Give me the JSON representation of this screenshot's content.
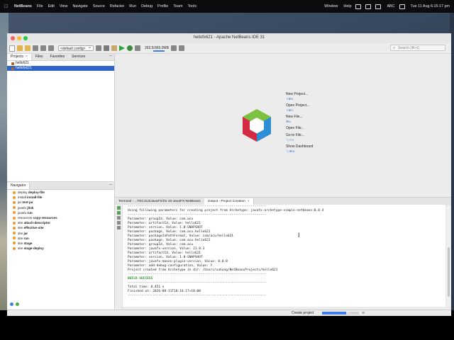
{
  "menubar": {
    "app": "NetBeans",
    "items": [
      "File",
      "Edit",
      "View",
      "Navigate",
      "Source",
      "Refactor",
      "Run",
      "Debug",
      "Profile",
      "Team",
      "Tools"
    ],
    "right_items": [
      "Window",
      "Help"
    ],
    "datetime": "Tue 11 Aug  6:15:17 pm",
    "input_label": "ABC"
  },
  "window": {
    "title": "hellofx621 - Apache NetBeans IDE 31"
  },
  "toolbar": {
    "config": "<default config>",
    "memory": "263.5/365.0MB",
    "search_placeholder": "Search (⌘+I)"
  },
  "projects_panel": {
    "tabs": [
      "Projects",
      "Files",
      "Favorites",
      "Services"
    ],
    "items": [
      {
        "label": "hello621",
        "selected": false
      },
      {
        "label": "hellofx621",
        "selected": true
      }
    ]
  },
  "navigator": {
    "title": "Navigator",
    "items": [
      {
        "phase": "deploy",
        "goal": "deploy-file"
      },
      {
        "phase": "install",
        "goal": "install-file"
      },
      {
        "phase": "jar",
        "goal": "test-jar"
      },
      {
        "phase": "javafx",
        "goal": "jlink"
      },
      {
        "phase": "javafx",
        "goal": "run"
      },
      {
        "phase": "resources",
        "goal": "copy-resources"
      },
      {
        "phase": "site",
        "goal": "attach-descriptor"
      },
      {
        "phase": "site",
        "goal": "effective-site"
      },
      {
        "phase": "site",
        "goal": "jar"
      },
      {
        "phase": "site",
        "goal": "run"
      },
      {
        "phase": "site",
        "goal": "stage"
      },
      {
        "phase": "site",
        "goal": "stage-deploy"
      }
    ]
  },
  "start_page": {
    "links": [
      {
        "label": "New Project...",
        "shortcut": "⇧⌘N"
      },
      {
        "label": "Open Project...",
        "shortcut": "⇧⌘O"
      },
      {
        "label": "New File...",
        "shortcut": "⌘N"
      },
      {
        "label": "Open File...",
        "shortcut": ""
      },
      {
        "label": "Go to File...",
        "shortcut": "⌥⇧O"
      },
      {
        "label": "Show Dashboard",
        "shortcut": "⌥⌘W"
      }
    ]
  },
  "output": {
    "tabs": [
      "Terminal - ...TEC313/JavaFX/01-10-JavaFX-NetBeans",
      "Output - Project Creation"
    ],
    "lines": [
      "------------------------------------------------------------------------",
      "Using following parameters for creating project from Archetype: javafx-archetype-simple-netbeans:0.0.4",
      "------------------------------------------------------------------------",
      "Parameter: groupId, Value: com.acu",
      "Parameter: artifactId, Value: hello621",
      "Parameter: version, Value: 1.0-SNAPSHOT",
      "Parameter: package, Value: com.acu.hello621",
      "Parameter: packageInPathFormat, Value: com/acu/hello621",
      "Parameter: package, Value: com.acu.hello621",
      "Parameter: groupId, Value: com.acu",
      "Parameter: javafx-version, Value: 21.0.3",
      "Parameter: artifactId, Value: hello621",
      "Parameter: version, Value: 1.0-SNAPSHOT",
      "Parameter: javafx-maven-plugin-version, Value: 0.0.8",
      "Parameter: add-debug-configuration, Value: Y",
      "Project created from Archetype in dir: /Users/xuhung/NetBeansProjects/hello621",
      "------------------------------------------------------------------------",
      "BUILD SUCCESS",
      "------------------------------------------------------------------------",
      "Total time:  0.451 s",
      "Finished at: 2026-08-11T18:16:17+10:00",
      "------------------------------------------------------------------------"
    ]
  },
  "status": {
    "task": "Create project",
    "progress_text": "0%",
    "progress_fraction": 0.65
  },
  "colors": {
    "selection": "#2f65ca",
    "build_success": "#2a8a2a",
    "progress": "#3f7ee8"
  }
}
